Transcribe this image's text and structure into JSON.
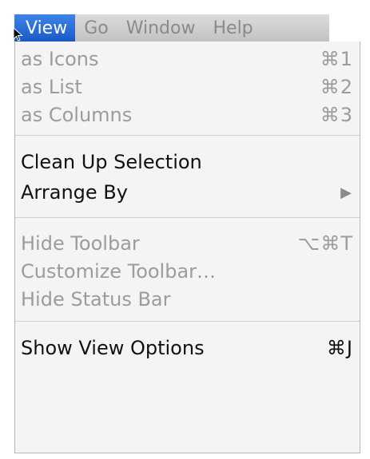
{
  "menubar": {
    "items": [
      {
        "label": "View",
        "active": true
      },
      {
        "label": "Go",
        "active": false
      },
      {
        "label": "Window",
        "active": false
      },
      {
        "label": "Help",
        "active": false
      }
    ]
  },
  "dropdown": {
    "groups": [
      [
        {
          "label": "as Icons",
          "shortcut": "⌘1",
          "enabled": false
        },
        {
          "label": "as List",
          "shortcut": "⌘2",
          "enabled": false
        },
        {
          "label": "as Columns",
          "shortcut": "⌘3",
          "enabled": false
        }
      ],
      [
        {
          "label": "Clean Up Selection",
          "shortcut": "",
          "enabled": true
        },
        {
          "label": "Arrange By",
          "shortcut": "",
          "enabled": true,
          "submenu": true
        }
      ],
      [
        {
          "label": "Hide Toolbar",
          "shortcut": "⌥⌘T",
          "enabled": false
        },
        {
          "label": "Customize Toolbar…",
          "shortcut": "",
          "enabled": false
        },
        {
          "label": "Hide Status Bar",
          "shortcut": "",
          "enabled": false
        }
      ],
      [
        {
          "label": "Show View Options",
          "shortcut": "⌘J",
          "enabled": true
        }
      ]
    ]
  },
  "colors": {
    "menubar_bg": "#c8c8c8",
    "active_bg": "#1f5fd0",
    "menu_bg": "#f4f4f4",
    "disabled_text": "#9c9c9c",
    "enabled_text": "#111111"
  }
}
